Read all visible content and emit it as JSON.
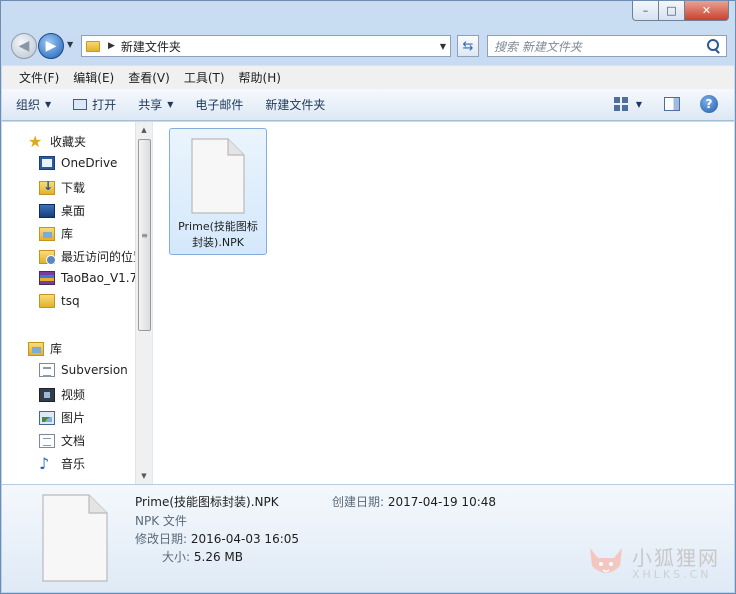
{
  "window": {
    "caption_min": "–",
    "caption_max": "□",
    "caption_close": "✕"
  },
  "address_bar": {
    "path": "新建文件夹",
    "search_placeholder": "搜索 新建文件夹"
  },
  "menu": [
    "文件(F)",
    "编辑(E)",
    "查看(V)",
    "工具(T)",
    "帮助(H)"
  ],
  "commands": {
    "organize": "组织",
    "open": "打开",
    "share": "共享",
    "email": "电子邮件",
    "new_folder": "新建文件夹"
  },
  "nav": {
    "favorites": "收藏夹",
    "favorites_items": [
      "OneDrive",
      "下载",
      "桌面",
      "库",
      "最近访问的位置",
      "TaoBao_V1.7",
      "tsq"
    ],
    "libraries": "库",
    "library_items": [
      "Subversion",
      "视频",
      "图片",
      "文档",
      "音乐"
    ]
  },
  "files": [
    {
      "name": "Prime(技能图标封装).NPK",
      "line1": "Prime(技能图标",
      "line2": "封装).NPK"
    }
  ],
  "details": {
    "name": "Prime(技能图标封装).NPK",
    "type": "NPK 文件",
    "modified_label": "修改日期:",
    "modified_value": "2016-04-03 16:05",
    "size_label": "大小:",
    "size_value": "5.26 MB",
    "created_label": "创建日期:",
    "created_value": "2017-04-19 10:48"
  },
  "watermark": {
    "title": "小狐狸网",
    "subtitle": "XHLKS.CN"
  }
}
